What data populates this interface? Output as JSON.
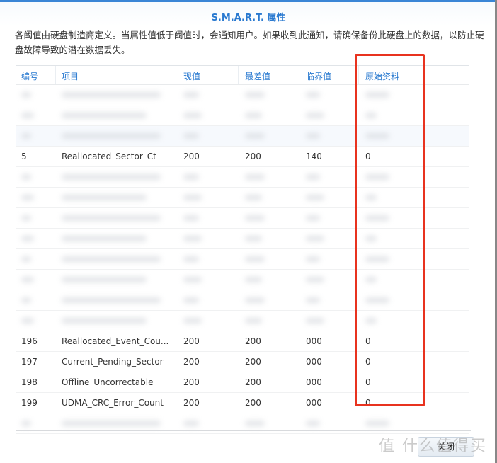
{
  "dialog": {
    "title": "S.M.A.R.T. 属性",
    "description": "各阈值由硬盘制造商定义。当属性值低于阈值时，会通知用户。如果收到此通知，请确保备份此硬盘上的数据，以防止硬盘故障导致的潜在数据丢失。"
  },
  "table": {
    "headers": [
      "编号",
      "项目",
      "现值",
      "最差值",
      "临界值",
      "原始资料"
    ],
    "rows": [
      {
        "id": "5",
        "name": "Reallocated_Sector_Ct",
        "value": "200",
        "worst": "200",
        "threshold": "140",
        "raw": "0"
      },
      {
        "id": "196",
        "name": "Reallocated_Event_Cou...",
        "value": "200",
        "worst": "200",
        "threshold": "000",
        "raw": "0"
      },
      {
        "id": "197",
        "name": "Current_Pending_Sector",
        "value": "200",
        "worst": "200",
        "threshold": "000",
        "raw": "0"
      },
      {
        "id": "198",
        "name": "Offline_Uncorrectable",
        "value": "200",
        "worst": "200",
        "threshold": "000",
        "raw": "0"
      },
      {
        "id": "199",
        "name": "UDMA_CRC_Error_Count",
        "value": "200",
        "worst": "200",
        "threshold": "000",
        "raw": "0"
      }
    ]
  },
  "footer": {
    "close_label": "关闭"
  },
  "watermark": "值 什么值得买",
  "colors": {
    "accent": "#2a7ad0",
    "highlight": "#e8331f"
  }
}
